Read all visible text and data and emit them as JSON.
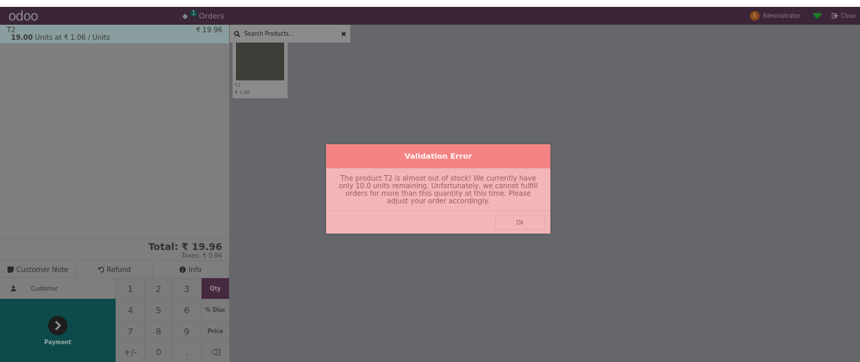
{
  "header": {
    "logo": "odoo",
    "orders_badge": "1",
    "orders_label": "Orders",
    "user_initial": "A",
    "user_name": "Administrator",
    "close_label": "Close"
  },
  "order_lines": [
    {
      "product": "T2",
      "price": "₹ 19.96",
      "quantity": "19.00",
      "detail": "Units at ₹ 1.06 / Units",
      "selected": true
    }
  ],
  "summary": {
    "total": "Total: ₹ 19.96",
    "taxes": "Taxes: ₹ 0.96"
  },
  "control_buttons": [
    {
      "kind": "note",
      "label": "Customer Note"
    },
    {
      "kind": "refund",
      "label": "Refund"
    },
    {
      "kind": "info",
      "label": "Info"
    }
  ],
  "customer_button": "Customer",
  "payment_button": "Payment",
  "numpad": [
    {
      "kind": "digit",
      "label": "1",
      "selected": false
    },
    {
      "kind": "digit",
      "label": "2",
      "selected": false
    },
    {
      "kind": "digit",
      "label": "3",
      "selected": false
    },
    {
      "kind": "mode",
      "label": "Qty",
      "selected": true
    },
    {
      "kind": "digit",
      "label": "4",
      "selected": false
    },
    {
      "kind": "digit",
      "label": "5",
      "selected": false
    },
    {
      "kind": "digit",
      "label": "6",
      "selected": false
    },
    {
      "kind": "mode",
      "label": "% Disc",
      "selected": false
    },
    {
      "kind": "digit",
      "label": "7",
      "selected": false
    },
    {
      "kind": "digit",
      "label": "8",
      "selected": false
    },
    {
      "kind": "digit",
      "label": "9",
      "selected": false
    },
    {
      "kind": "mode",
      "label": "Price",
      "selected": false
    },
    {
      "kind": "digit",
      "label": "+/-",
      "selected": false
    },
    {
      "kind": "digit",
      "label": "0",
      "selected": false
    },
    {
      "kind": "digit",
      "label": ".",
      "selected": false
    },
    {
      "kind": "backspace",
      "selected": false
    }
  ],
  "search": {
    "placeholder": "Search Products..."
  },
  "products": [
    {
      "name": "T2",
      "price": "₹ 1.06"
    }
  ],
  "dialog": {
    "title": "Validation Error",
    "message": "The product T2 is almost out of stock! We currently have only 10.0 units remaining. Unfortunately, we cannot fulfill orders for more than this quantity at this time. Please adjust your order accordingly.",
    "button": "Ok"
  }
}
